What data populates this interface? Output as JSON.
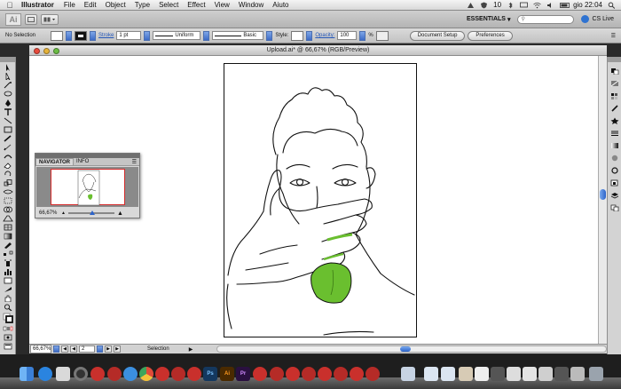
{
  "menubar": {
    "app_name": "Illustrator",
    "items": [
      "File",
      "Edit",
      "Object",
      "Type",
      "Select",
      "Effect",
      "View",
      "Window",
      "Aiuto"
    ],
    "status_number": "10",
    "clock": "gio 22:04"
  },
  "appbar": {
    "logo": "Ai",
    "workspace": "ESSENTIALS",
    "cs_live": "CS Live"
  },
  "control": {
    "selection": "No Selection",
    "stroke_label": "Stroke",
    "stroke_weight": "1 pt",
    "profile": "Uniform",
    "brush": "Basic",
    "style_label": "Style:",
    "opacity_label": "Opacity:",
    "opacity_value": "100",
    "opacity_unit": "%",
    "document_setup": "Document Setup",
    "preferences": "Preferences"
  },
  "document": {
    "title": "Upload.ai* @ 66,67% (RGB/Preview)",
    "tongue_color": "#6abf2f"
  },
  "status": {
    "zoom": "66,67%",
    "artboard_number": "2",
    "mode": "Selection"
  },
  "navigator": {
    "tabs": [
      "NAVIGATOR",
      "INFO"
    ],
    "zoom": "66,67%"
  }
}
